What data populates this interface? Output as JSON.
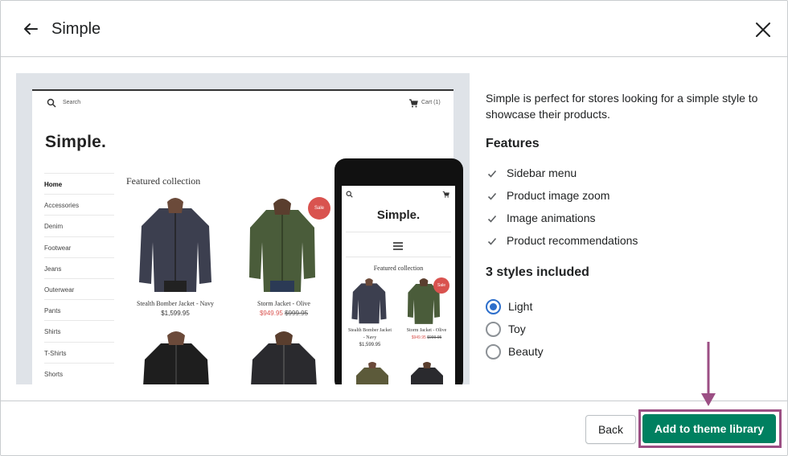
{
  "header": {
    "title": "Simple"
  },
  "preview": {
    "desktop": {
      "search_label": "Search",
      "cart_label": "Cart (1)",
      "logo": "Simple.",
      "nav": [
        "Home",
        "Accessories",
        "Denim",
        "Footwear",
        "Jeans",
        "Outerwear",
        "Pants",
        "Shirts",
        "T-Shirts",
        "Shorts"
      ],
      "featured_title": "Featured collection",
      "products": [
        {
          "name": "Stealth Bomber Jacket - Navy",
          "price": "$1,599.95"
        },
        {
          "name": "Storm Jacket - Olive",
          "sale_price": "$949.95",
          "old_price": "$999.95",
          "badge": "Sale"
        }
      ]
    },
    "phone": {
      "logo": "Simple.",
      "featured_title": "Featured collection",
      "products": [
        {
          "name_line1": "Stealth Bomber Jacket",
          "name_line2": "- Navy",
          "price": "$1,599.95"
        },
        {
          "name_line1": "Storm Jacket - Olive",
          "sale_price": "$949.95",
          "old_price": "$999.95",
          "badge": "Sale"
        }
      ]
    }
  },
  "description": "Simple is perfect for stores looking for a simple style to showcase their products.",
  "features": {
    "title": "Features",
    "items": [
      "Sidebar menu",
      "Product image zoom",
      "Image animations",
      "Product recommendations"
    ]
  },
  "styles": {
    "title": "3 styles included",
    "options": [
      "Light",
      "Toy",
      "Beauty"
    ],
    "selected": "Light"
  },
  "footer": {
    "back_label": "Back",
    "primary_label": "Add to theme library"
  },
  "colors": {
    "primary": "#008060",
    "radio_selected": "#2c6ecb",
    "annotation": "#9c4f84",
    "sale": "#d9534f"
  }
}
